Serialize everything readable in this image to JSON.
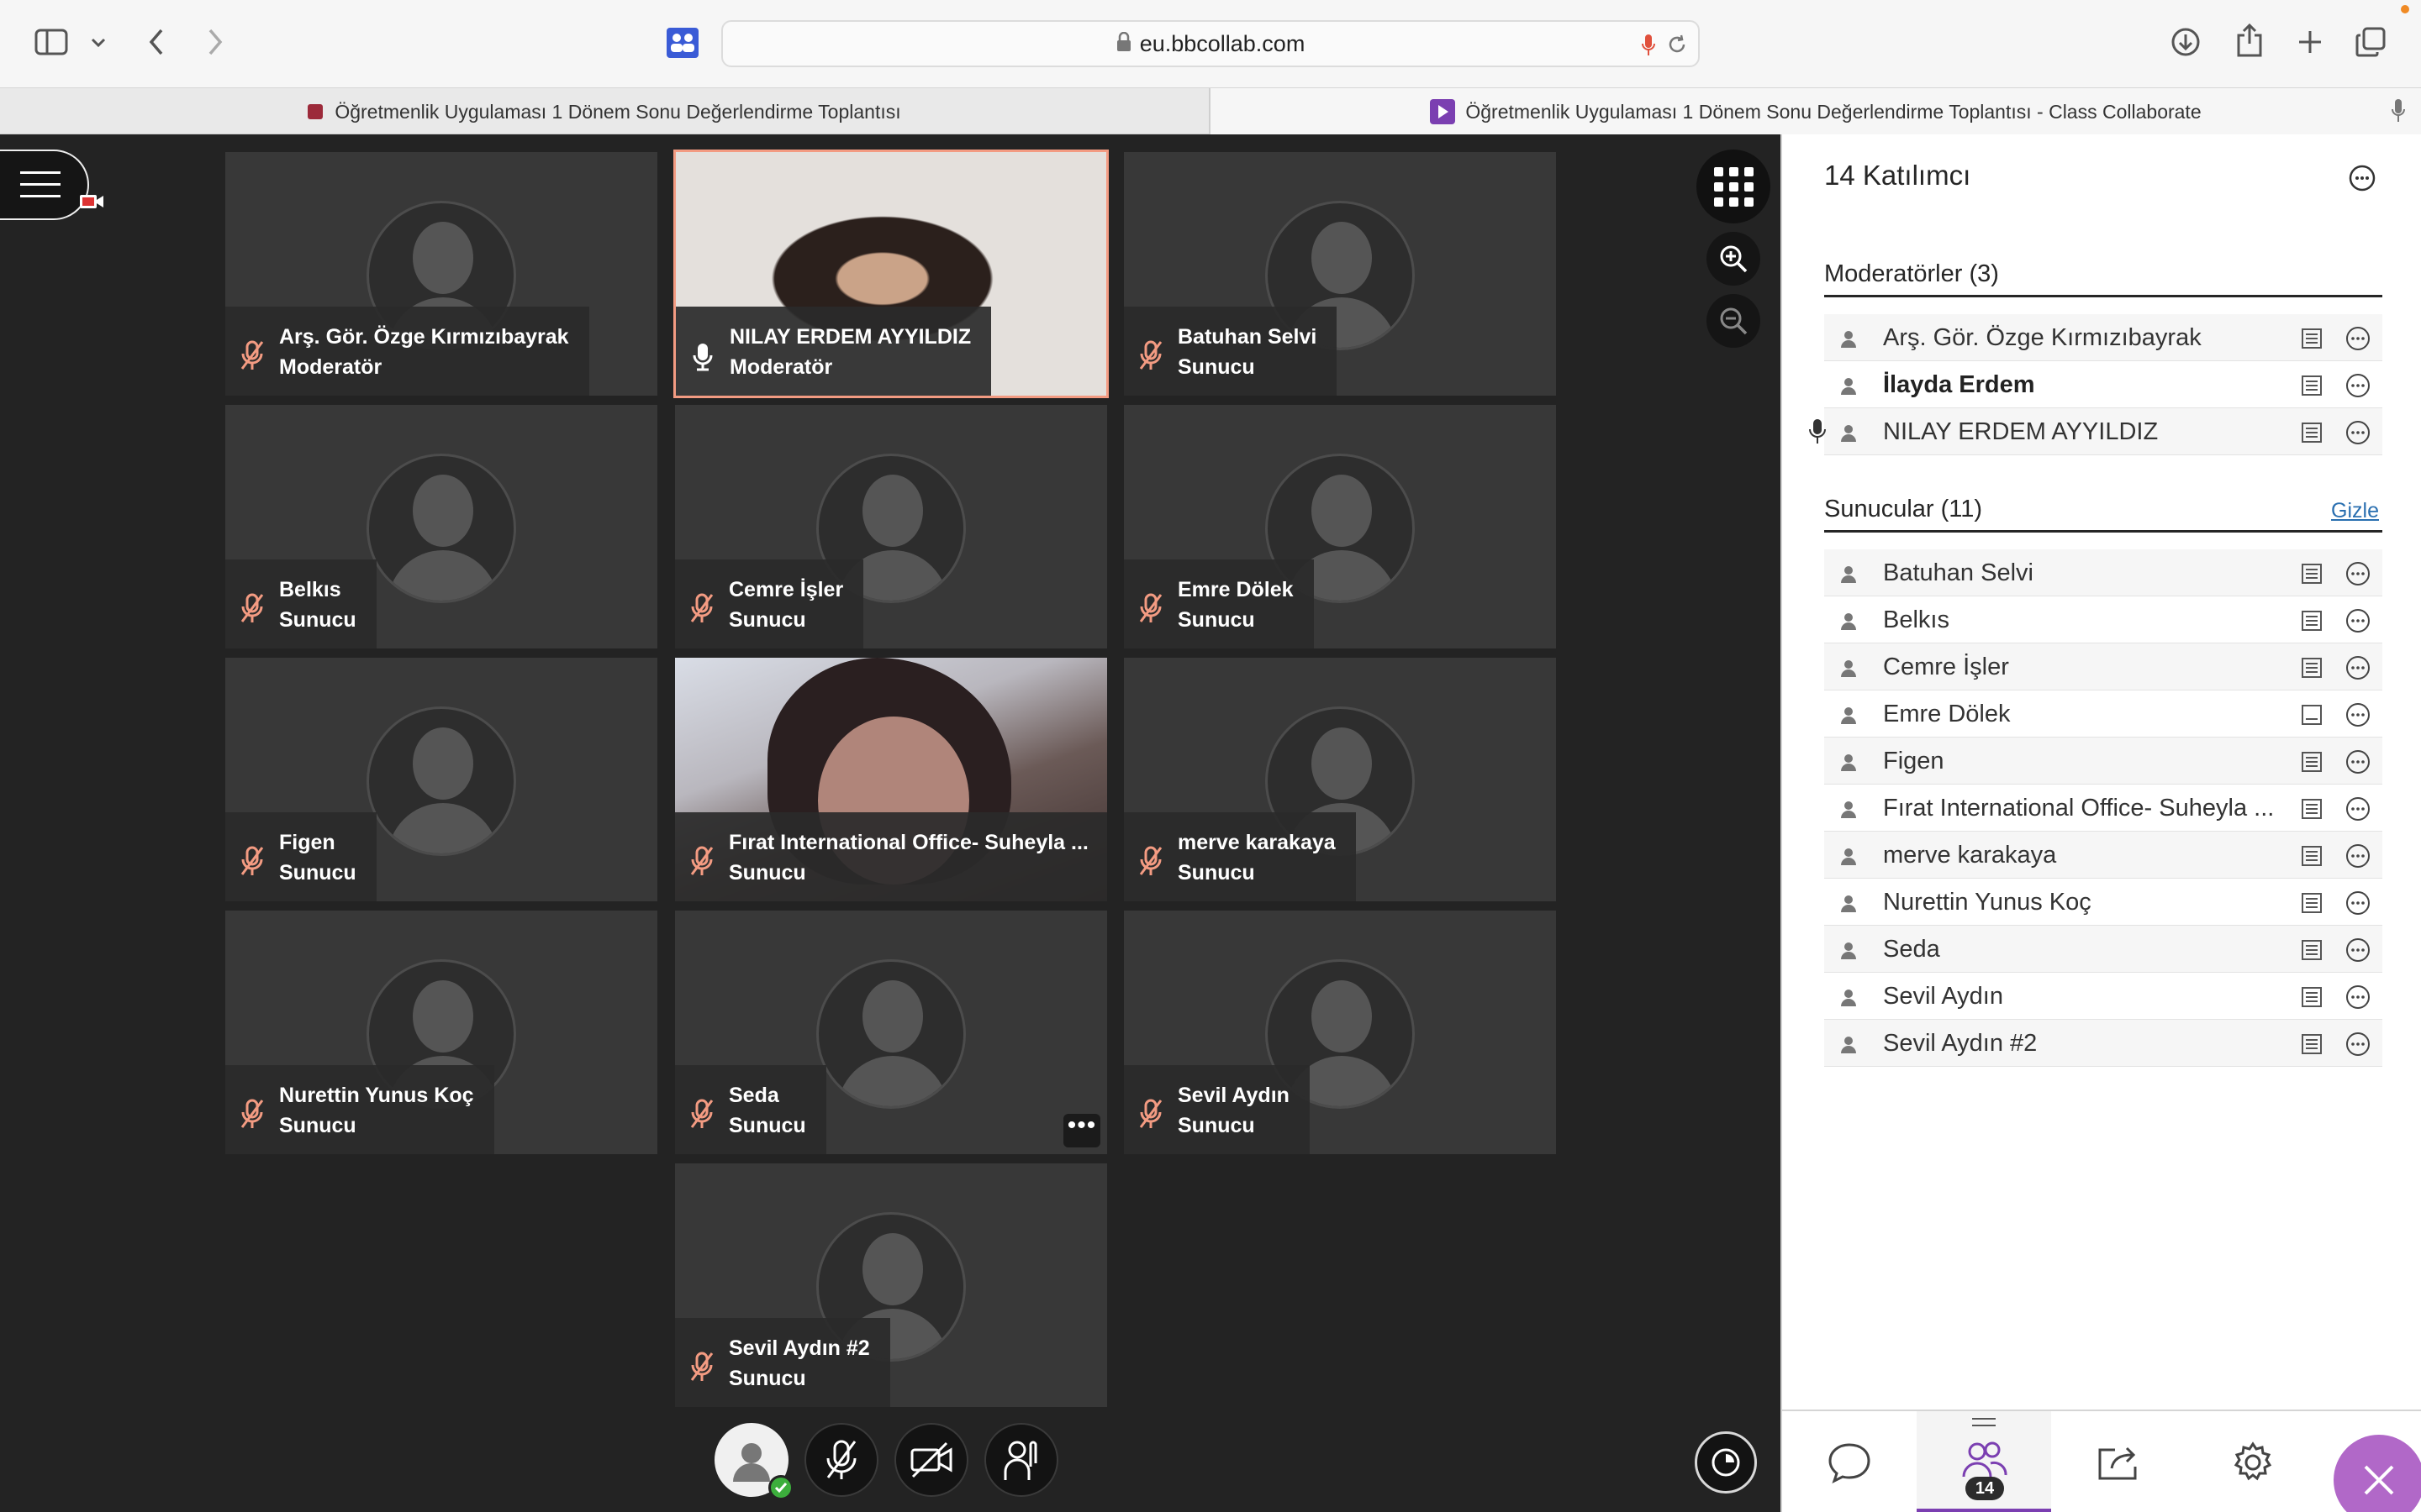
{
  "browser": {
    "url": "eu.bbcollab.com",
    "tabs": [
      {
        "title": "Öğretmenlik Uygulaması 1 Dönem Sonu Değerlendirme Toplantısı"
      },
      {
        "title": "Öğretmenlik Uygulaması 1 Dönem Sonu Değerlendirme Toplantısı - Class Collaborate"
      }
    ]
  },
  "tiles": [
    {
      "name": "Arş. Gör. Özge Kırmızıbayrak",
      "role": "Moderatör"
    },
    {
      "name": "NILAY ERDEM AYYILDIZ",
      "role": "Moderatör"
    },
    {
      "name": "Batuhan Selvi",
      "role": "Sunucu"
    },
    {
      "name": "Belkıs",
      "role": "Sunucu"
    },
    {
      "name": "Cemre İşler",
      "role": "Sunucu"
    },
    {
      "name": "Emre Dölek",
      "role": "Sunucu"
    },
    {
      "name": "Figen",
      "role": "Sunucu"
    },
    {
      "name": "Fırat International Office- Suheyla ...",
      "role": "Sunucu"
    },
    {
      "name": "merve karakaya",
      "role": "Sunucu"
    },
    {
      "name": "Nurettin Yunus Koç",
      "role": "Sunucu"
    },
    {
      "name": "Seda",
      "role": "Sunucu"
    },
    {
      "name": "Sevil Aydın",
      "role": "Sunucu"
    },
    {
      "name": "Sevil Aydın #2",
      "role": "Sunucu"
    }
  ],
  "tile_more": "•••",
  "panel": {
    "title": "14 Katılımcı",
    "moderators_title": "Moderatörler (3)",
    "moderators": [
      {
        "name": "Arş. Gör. Özge Kırmızıbayrak"
      },
      {
        "name": "İlayda Erdem"
      },
      {
        "name": "NILAY ERDEM AYYILDIZ"
      }
    ],
    "presenters_title": "Sunucular (11)",
    "hide_link": "Gizle",
    "presenters": [
      {
        "name": "Batuhan Selvi"
      },
      {
        "name": "Belkıs"
      },
      {
        "name": "Cemre İşler"
      },
      {
        "name": "Emre Dölek"
      },
      {
        "name": "Figen"
      },
      {
        "name": "Fırat International Office- Suheyla ..."
      },
      {
        "name": "merve karakaya"
      },
      {
        "name": "Nurettin Yunus Koç"
      },
      {
        "name": "Seda"
      },
      {
        "name": "Sevil Aydın"
      },
      {
        "name": "Sevil Aydın #2"
      }
    ],
    "participant_count": "14"
  },
  "colors": {
    "accent": "#7b3fb1",
    "close_button": "#b168c8",
    "mic_muted": "#f39b82",
    "speaking_border": "#f39b82"
  },
  "icons": [
    "sidebar-icon",
    "back-icon",
    "forward-icon",
    "lock-icon",
    "mic-icon",
    "reload-icon",
    "download-icon",
    "share-icon",
    "plus-icon",
    "tabs-icon",
    "grid-view-icon",
    "zoom-in-icon",
    "zoom-out-icon",
    "mic-muted-icon",
    "camera-off-icon",
    "hand-raise-icon",
    "chat-icon",
    "participants-icon",
    "share-content-icon",
    "settings-icon",
    "close-icon"
  ]
}
